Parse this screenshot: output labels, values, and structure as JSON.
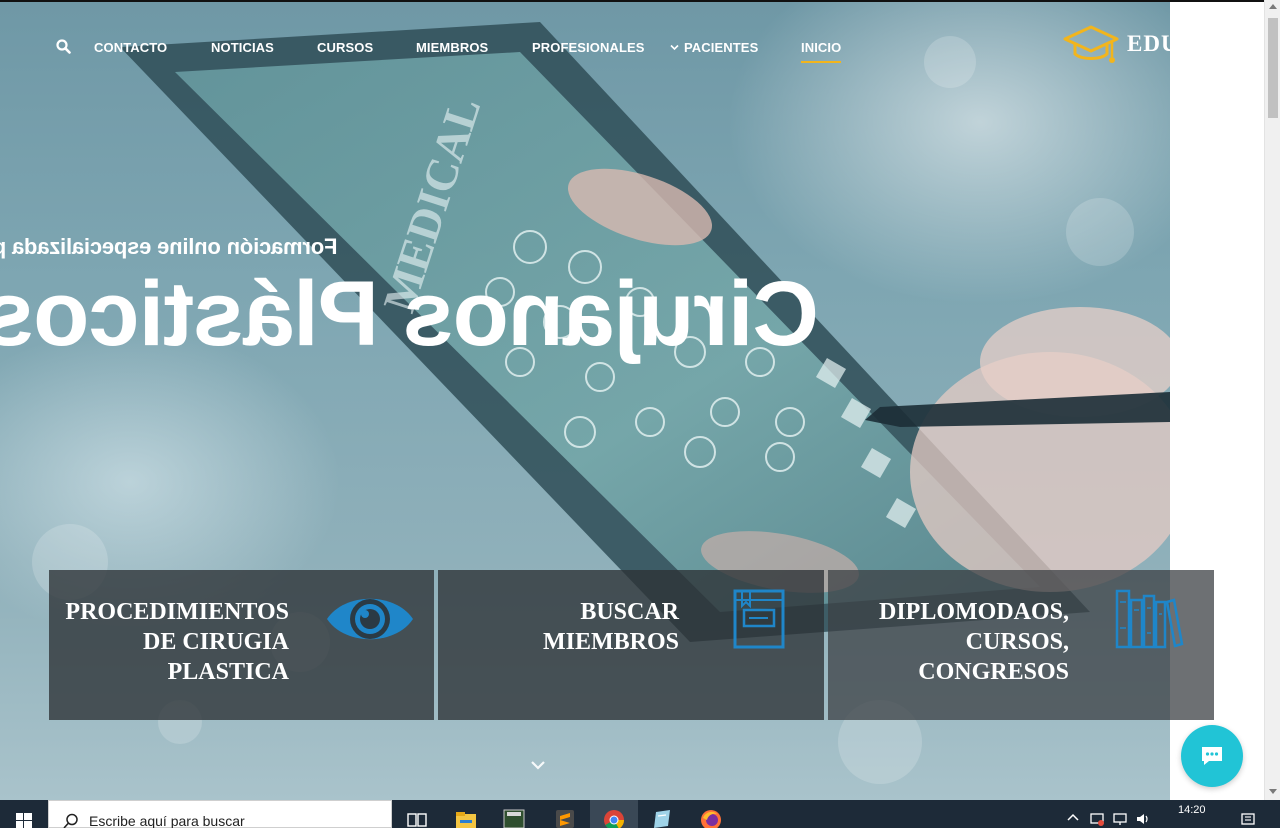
{
  "nav": {
    "items": [
      {
        "label": "CONTACTO"
      },
      {
        "label": "NOTICIAS"
      },
      {
        "label": "CURSOS"
      },
      {
        "label": "MIEMBROS"
      },
      {
        "label": "PROFESIONALES"
      },
      {
        "label": "PACIENTES"
      },
      {
        "label": "INICIO",
        "active": true
      }
    ],
    "search_icon": "search-icon",
    "dropdown_icon": "chevron-down-icon"
  },
  "logo": {
    "text": "EDU",
    "icon": "graduation-cap-icon",
    "color": "#f2b51d"
  },
  "hero": {
    "subtitle": "Formación online especializada p",
    "title": "Cirujanos Plásticos"
  },
  "boxes": [
    {
      "label_lines": [
        "PROCEDIMIENTOS",
        "DE CIRUGIA",
        "PLASTICA"
      ],
      "icon": "eye-icon"
    },
    {
      "label_lines": [
        "BUSCAR",
        "MIEMBROS"
      ],
      "icon": "book-icon"
    },
    {
      "label_lines": [
        "DIPLOMODAOS,",
        "CURSOS,",
        "CONGRESOS"
      ],
      "icon": "books-icon"
    }
  ],
  "accent_color": "#1f86c9",
  "chat": {
    "icon": "chat-icon",
    "color": "#21c4d6"
  },
  "taskbar": {
    "search_placeholder": "Escribe aquí para buscar",
    "time": "14:20",
    "apps": [
      "task-view-icon",
      "file-explorer-icon",
      "studio-app-icon",
      "sublime-text-icon",
      "chrome-icon",
      "notes-app-icon",
      "firefox-icon"
    ]
  }
}
